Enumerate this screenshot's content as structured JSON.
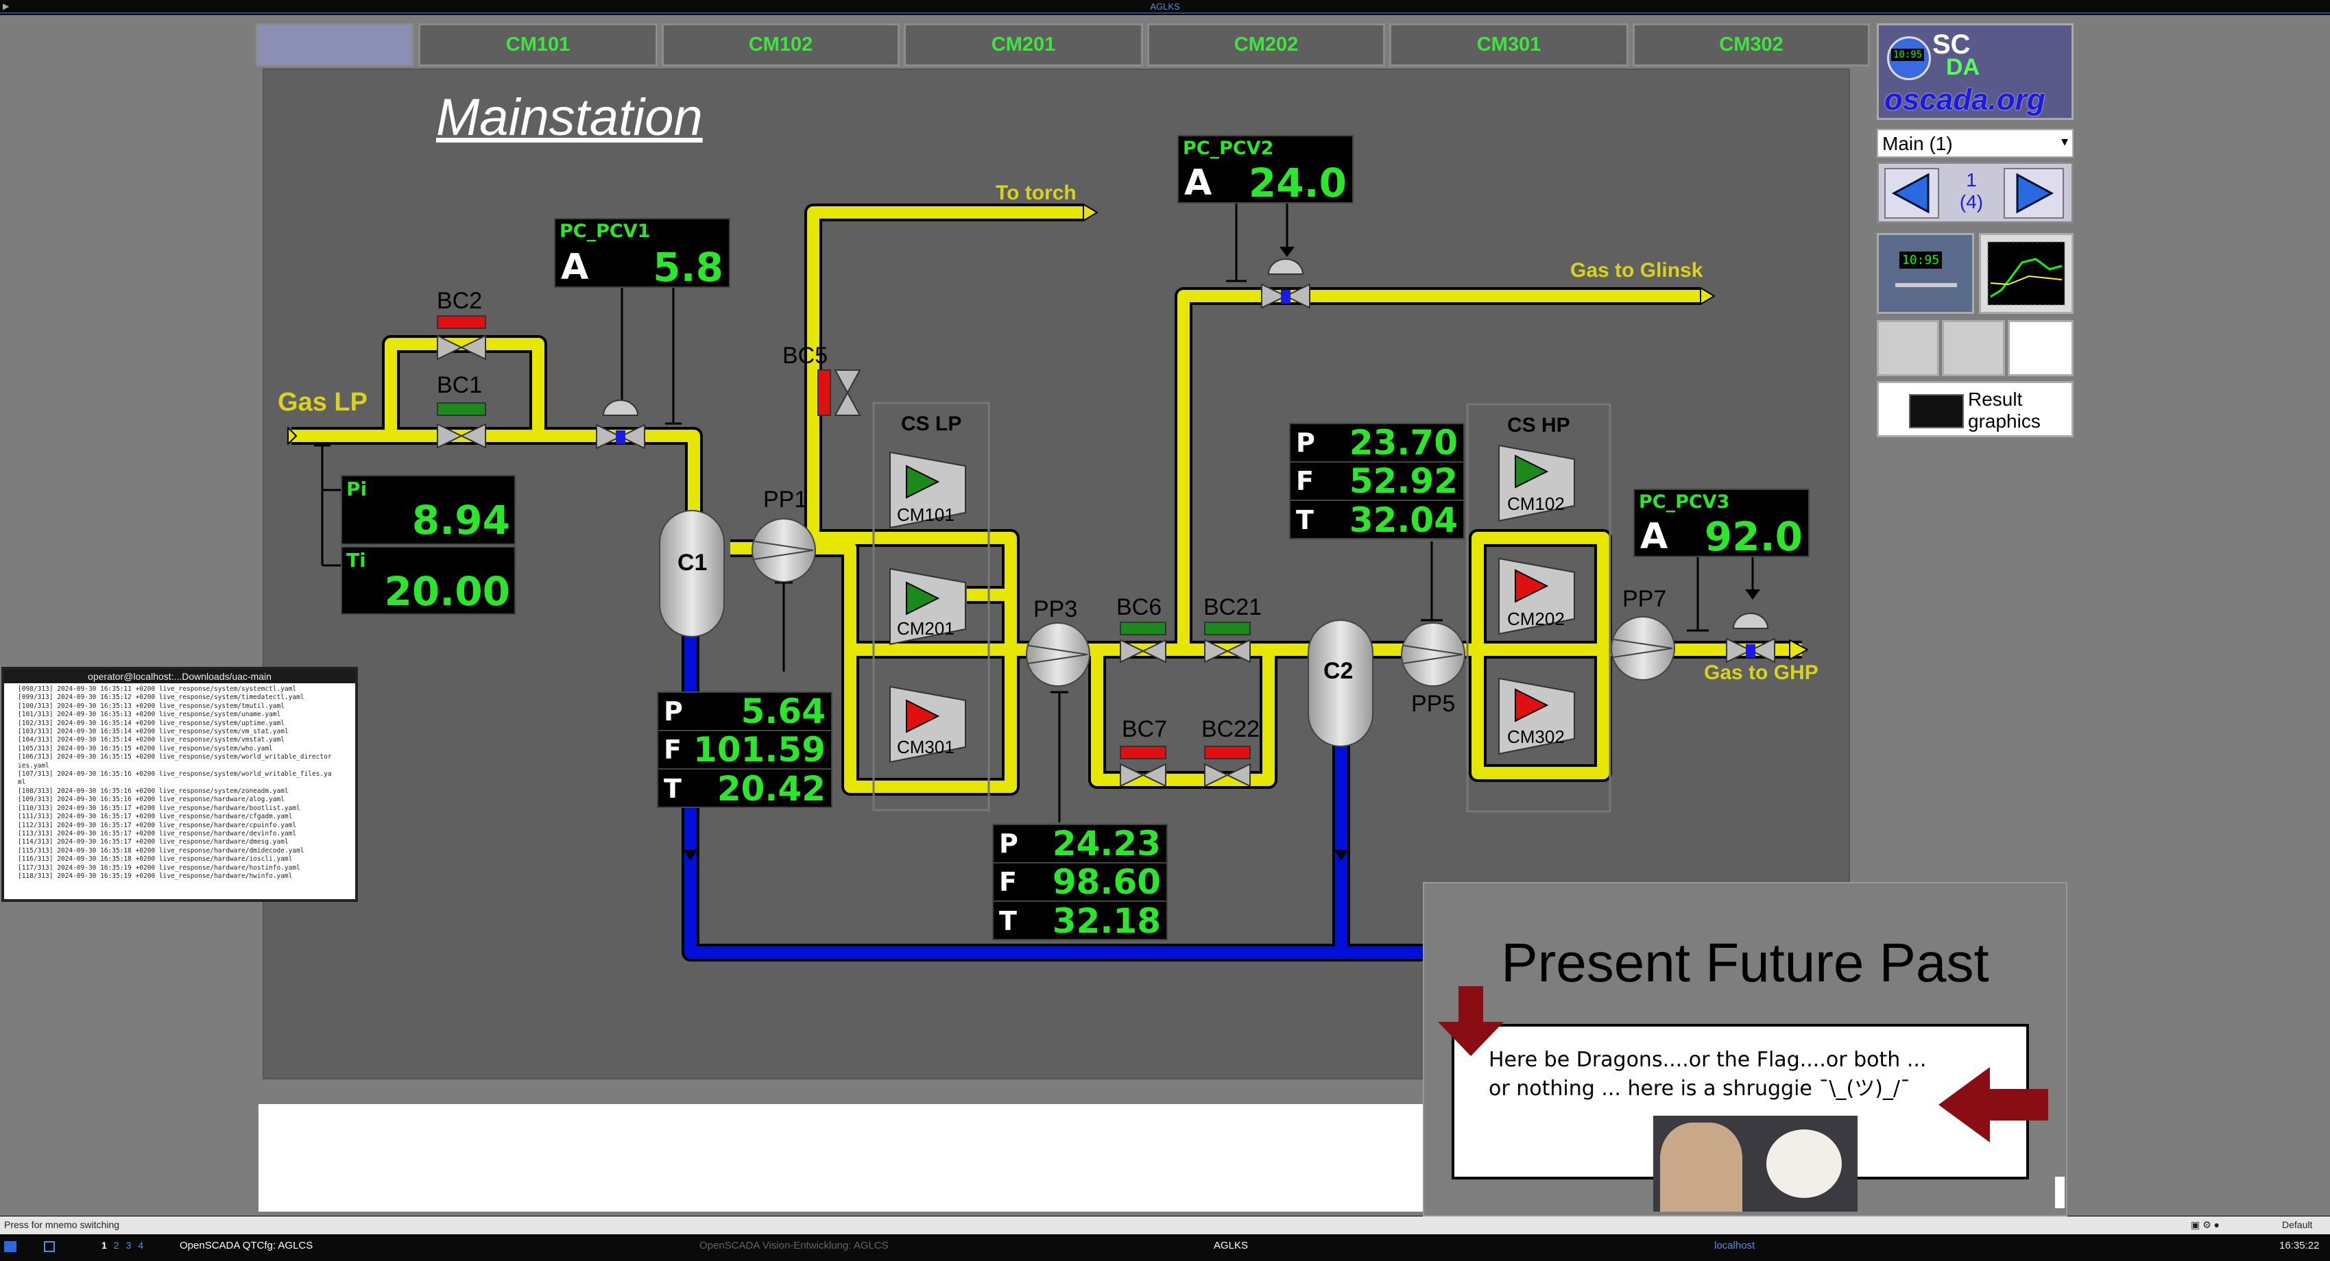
{
  "window_title": "AGLKS",
  "tabs": [
    "",
    "CM101",
    "CM102",
    "CM201",
    "CM202",
    "CM301",
    "CM302"
  ],
  "mnemo_title": "Mainstation",
  "labels": {
    "gas_lp": "Gas LP",
    "to_torch": "To torch",
    "gas_to_glinsk": "Gas to Glinsk",
    "gas_to_ghp": "Gas to GHP",
    "bc1": "BC1",
    "bc2": "BC2",
    "bc5": "BC5",
    "bc6": "BC6",
    "bc7": "BC7",
    "bc21": "BC21",
    "bc22": "BC22",
    "pp1": "PP1",
    "pp3": "PP3",
    "pp5": "PP5",
    "pp7": "PP7",
    "c1": "C1",
    "c2": "C2",
    "cs_lp": "CS LP",
    "cs_hp": "CS HP",
    "cm101": "CM101",
    "cm201": "CM201",
    "cm301": "CM301",
    "cm102": "CM102",
    "cm202": "CM202",
    "cm302": "CM302"
  },
  "controllers": {
    "pcv1": {
      "name": "PC_PCV1",
      "mode": "A",
      "value": "5.8"
    },
    "pcv2": {
      "name": "PC_PCV2",
      "mode": "A",
      "value": "24.0"
    },
    "pcv3": {
      "name": "PC_PCV3",
      "mode": "A",
      "value": "92.0"
    }
  },
  "inlet": {
    "pi_label": "Pi",
    "pi": "8.94",
    "ti_label": "Ti",
    "ti": "20.00"
  },
  "pft_labels": {
    "p": "P",
    "f": "F",
    "t": "T"
  },
  "pft_c1": {
    "p": "5.64",
    "f": "101.59",
    "t": "20.42"
  },
  "pft_pp3": {
    "p": "24.23",
    "f": "98.60",
    "t": "32.18"
  },
  "pft_hp": {
    "p": "23.70",
    "f": "52.92",
    "t": "32.04"
  },
  "right_panel": {
    "logo_sc": "SC",
    "logo_da": "DA",
    "logo_url": "oscada.org",
    "logo_clock": "10:95",
    "page_select": "Main (1)",
    "page_num": "1",
    "page_total": "(4)",
    "result_graphics": "Result graphics",
    "thumb_clock": "10:95"
  },
  "terminal": {
    "title": "operator@localhost:...Downloads/uac-main",
    "lines": [
      "[098/313] 2024-09-30 16:35:11 +0200 live_response/system/systemctl.yaml",
      "[099/313] 2024-09-30 16:35:12 +0200 live_response/system/timedatectl.yaml",
      "[100/313] 2024-09-30 16:35:13 +0200 live_response/system/tmutil.yaml",
      "[101/313] 2024-09-30 16:35:13 +0200 live_response/system/uname.yaml",
      "[102/313] 2024-09-30 16:35:14 +0200 live_response/system/uptime.yaml",
      "[103/313] 2024-09-30 16:35:14 +0200 live_response/system/vm_stat.yaml",
      "[104/313] 2024-09-30 16:35:14 +0200 live_response/system/vmstat.yaml",
      "[105/313] 2024-09-30 16:35:15 +0200 live_response/system/who.yaml",
      "[106/313] 2024-09-30 16:35:15 +0200 live_response/system/world_writable_director",
      "ies.yaml",
      "[107/313] 2024-09-30 16:35:16 +0200 live_response/system/world_writable_files.ya",
      "ml",
      "[108/313] 2024-09-30 16:35:16 +0200 live_response/system/zoneadm.yaml",
      "[109/313] 2024-09-30 16:35:16 +0200 live_response/hardware/alog.yaml",
      "[110/313] 2024-09-30 16:35:17 +0200 live_response/hardware/bootlist.yaml",
      "[111/313] 2024-09-30 16:35:17 +0200 live_response/hardware/cfgadm.yaml",
      "[112/313] 2024-09-30 16:35:17 +0200 live_response/hardware/cpuinfo.yaml",
      "[113/313] 2024-09-30 16:35:17 +0200 live_response/hardware/devinfo.yaml",
      "[114/313] 2024-09-30 16:35:17 +0200 live_response/hardware/dmesg.yaml",
      "[115/313] 2024-09-30 16:35:18 +0200 live_response/hardware/dmidecode.yaml",
      "[116/313] 2024-09-30 16:35:18 +0200 live_response/hardware/ioscli.yaml",
      "[117/313] 2024-09-30 16:35:19 +0200 live_response/hardware/hostinfo.yaml",
      "[118/313] 2024-09-30 16:35:19 +0200 live_response/hardware/hwinfo.yaml"
    ]
  },
  "overlay": {
    "heading": "Present Future Past",
    "text": "Here be Dragons....or the Flag....or both ... or nothing ... here is a shruggie ¯\\_(ツ)_/¯"
  },
  "statusbar": {
    "left": "Press for mnemo switching",
    "right": "Default"
  },
  "taskbar": {
    "workspaces": [
      "1",
      "2",
      "3",
      "4"
    ],
    "app1": "OpenSCADA QTCfg: AGLCS",
    "app2": "OpenSCADA Vision-Entwicklung: AGLCS",
    "app3": "AGLKS",
    "app4": "localhost",
    "clock": "16:35:22"
  },
  "colors": {
    "pipe_gas": "#e6e600",
    "pipe_return": "#0010c8",
    "value_green": "#2ce62c",
    "label_yellow": "#d9d21e",
    "valve_open": "#1a8a1a",
    "valve_closed": "#e01010",
    "arrow_dark_red": "#8a0d14"
  }
}
